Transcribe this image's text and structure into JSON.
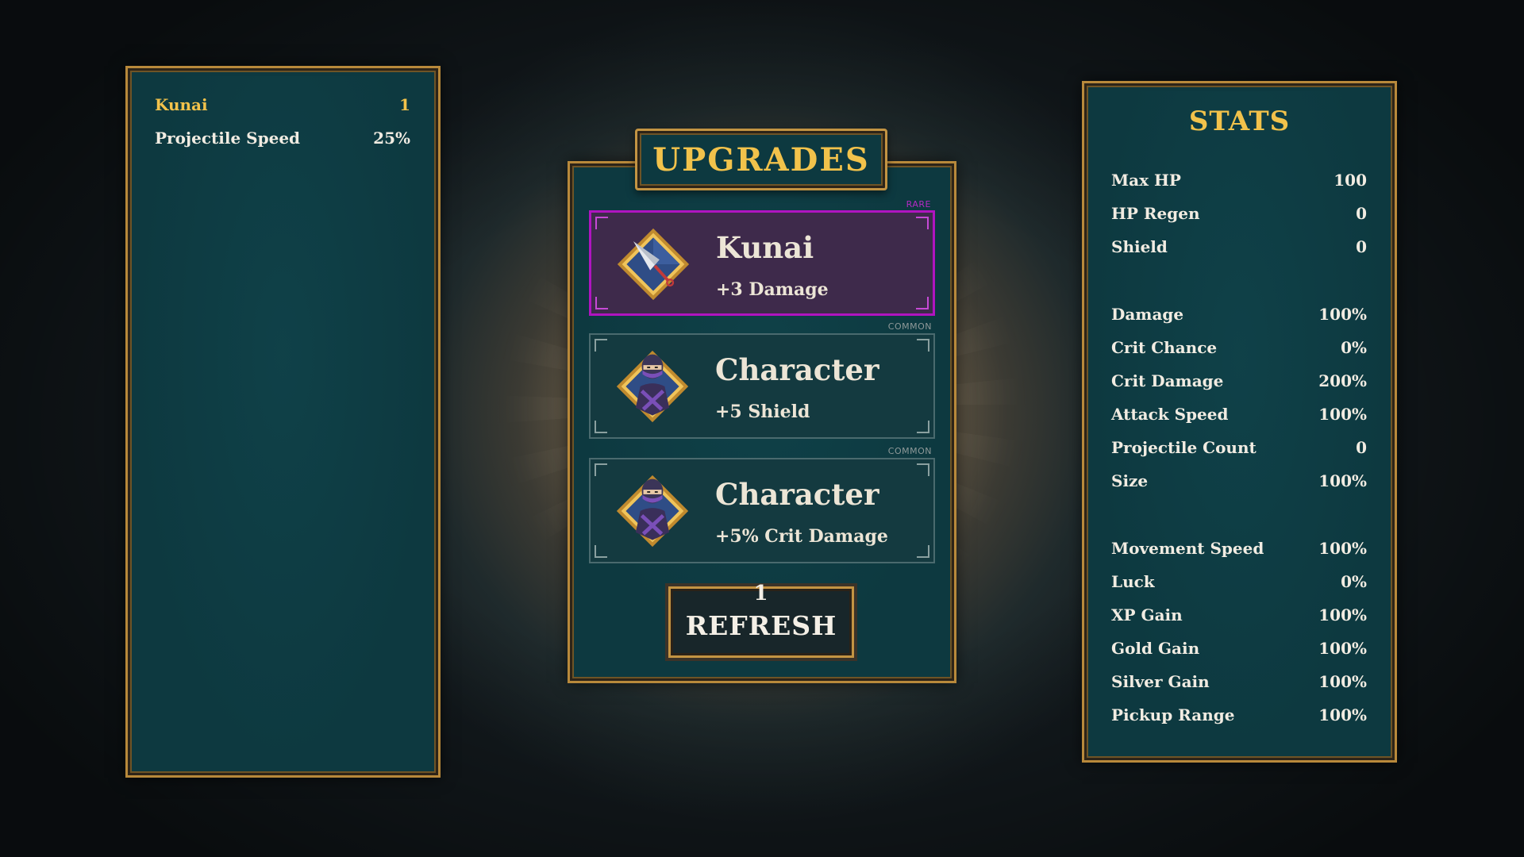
{
  "left_panel": {
    "rows": [
      {
        "label": "Kunai",
        "value": "1"
      },
      {
        "label": "Projectile Speed",
        "value": "25%"
      }
    ]
  },
  "upgrades": {
    "title": "UPGRADES",
    "cards": [
      {
        "rarity": "RARE",
        "name": "Kunai",
        "effect": "+3 Damage",
        "icon": "kunai-icon"
      },
      {
        "rarity": "COMMON",
        "name": "Character",
        "effect": "+5 Shield",
        "icon": "ninja-icon"
      },
      {
        "rarity": "COMMON",
        "name": "Character",
        "effect": "+5% Crit Damage",
        "icon": "ninja-icon"
      }
    ],
    "refresh_label": "REFRESH",
    "refresh_cost": "1"
  },
  "stats": {
    "title": "STATS",
    "rows": [
      {
        "label": "Max HP",
        "value": "100"
      },
      {
        "label": "HP Regen",
        "value": "0"
      },
      {
        "label": "Shield",
        "value": "0"
      },
      {
        "label": "Damage",
        "value": "100%"
      },
      {
        "label": "Crit Chance",
        "value": "0%"
      },
      {
        "label": "Crit Damage",
        "value": "200%"
      },
      {
        "label": "Attack Speed",
        "value": "100%"
      },
      {
        "label": "Projectile Count",
        "value": "0"
      },
      {
        "label": "Size",
        "value": "100%"
      },
      {
        "label": "Movement Speed",
        "value": "100%"
      },
      {
        "label": "Luck",
        "value": "0%"
      },
      {
        "label": "XP Gain",
        "value": "100%"
      },
      {
        "label": "Gold Gain",
        "value": "100%"
      },
      {
        "label": "Silver Gain",
        "value": "100%"
      },
      {
        "label": "Pickup Range",
        "value": "100%"
      }
    ]
  },
  "colors": {
    "panel_bg": "#0d3940",
    "gold_border": "#b8893b",
    "gold_text": "#f2c24b",
    "rare_purple": "#b014c0",
    "text": "#f1ece2"
  }
}
